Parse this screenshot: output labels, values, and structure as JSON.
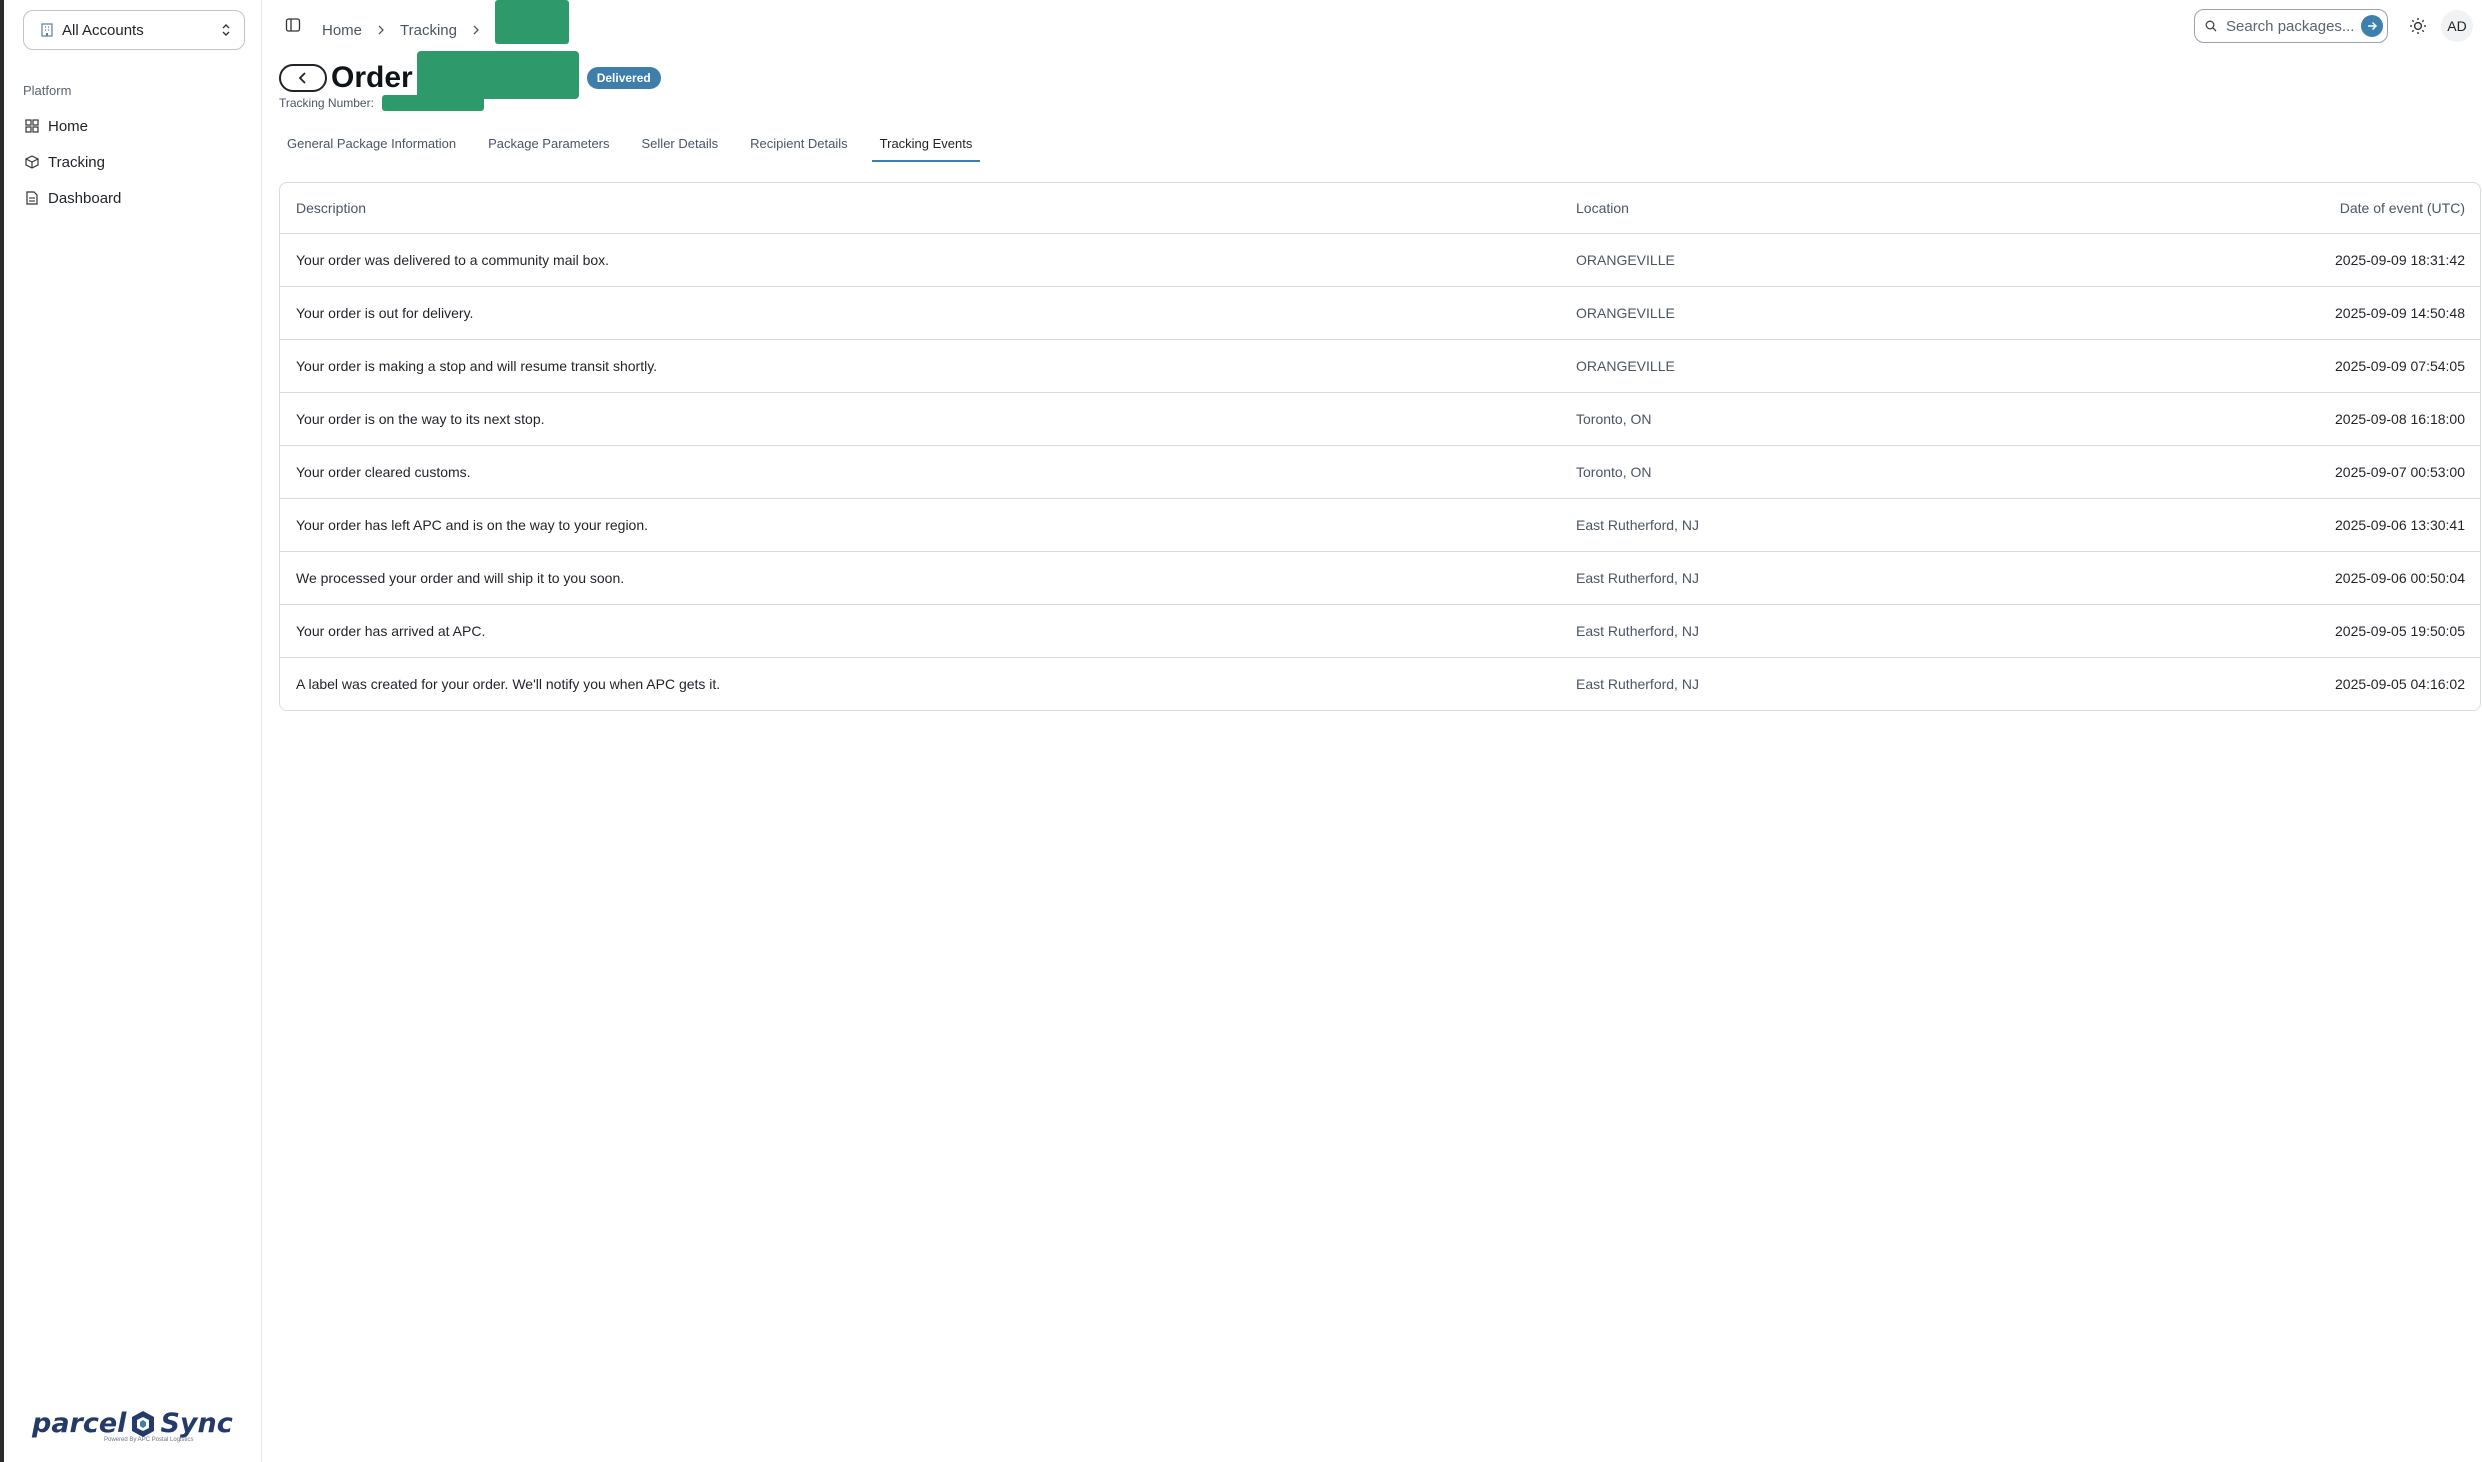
{
  "sidebar": {
    "account_select": "All Accounts",
    "section_label": "Platform",
    "items": [
      {
        "label": "Home",
        "icon": "grid-icon"
      },
      {
        "label": "Tracking",
        "icon": "package-icon"
      },
      {
        "label": "Dashboard",
        "icon": "file-icon"
      }
    ],
    "logo": {
      "brand_left": "parcel",
      "brand_right": "Sync",
      "tagline": "Powered By APC Postal Logistics"
    }
  },
  "header": {
    "breadcrumb": [
      "Home",
      "Tracking"
    ],
    "search_placeholder": "Search packages...",
    "avatar_initials": "AD"
  },
  "order": {
    "title": "Order",
    "status": "Delivered",
    "tracking_label": "Tracking Number:"
  },
  "tabs": [
    {
      "label": "General Package Information",
      "active": false
    },
    {
      "label": "Package Parameters",
      "active": false
    },
    {
      "label": "Seller Details",
      "active": false
    },
    {
      "label": "Recipient Details",
      "active": false
    },
    {
      "label": "Tracking Events",
      "active": true
    }
  ],
  "events_table": {
    "columns": [
      "Description",
      "Location",
      "Date of event (UTC)"
    ],
    "rows": [
      {
        "description": "Your order was delivered to a community mail box.",
        "location": "ORANGEVILLE",
        "date": "2025-09-09 18:31:42"
      },
      {
        "description": "Your order is out for delivery.",
        "location": "ORANGEVILLE",
        "date": "2025-09-09 14:50:48"
      },
      {
        "description": "Your order is making a stop and will resume transit shortly.",
        "location": "ORANGEVILLE",
        "date": "2025-09-09 07:54:05"
      },
      {
        "description": "Your order is on the way to its next stop.",
        "location": "Toronto, ON",
        "date": "2025-09-08 16:18:00"
      },
      {
        "description": "Your order cleared customs.",
        "location": "Toronto, ON",
        "date": "2025-09-07 00:53:00"
      },
      {
        "description": "Your order has left APC and is on the way to your region.",
        "location": "East Rutherford, NJ",
        "date": "2025-09-06 13:30:41"
      },
      {
        "description": "We processed your order and will ship it to you soon.",
        "location": "East Rutherford, NJ",
        "date": "2025-09-06 00:50:04"
      },
      {
        "description": "Your order has arrived at APC.",
        "location": "East Rutherford, NJ",
        "date": "2025-09-05 19:50:05"
      },
      {
        "description": "A label was created for your order. We'll notify you when APC gets it.",
        "location": "East Rutherford, NJ",
        "date": "2025-09-05 04:16:02"
      }
    ]
  },
  "colors": {
    "accent": "#3d7eab",
    "redaction": "#2e9a6b",
    "border": "#d8dce1"
  }
}
